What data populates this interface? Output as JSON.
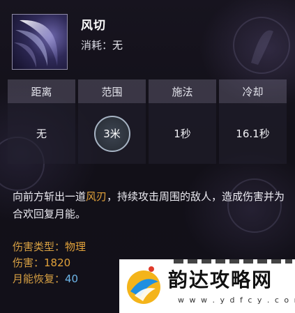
{
  "skill": {
    "name": "风切",
    "cost_label": "消耗：",
    "cost_value": "无"
  },
  "stats": {
    "headers": [
      "距离",
      "范围",
      "施法",
      "冷却"
    ],
    "values": [
      "无",
      "3米",
      "1秒",
      "16.1秒"
    ]
  },
  "description": {
    "prefix": "向前方斩出一道",
    "highlight": "风刃",
    "suffix": "，持续攻击周围的敌人，造成伤害并为合欢回复月能。"
  },
  "attributes": {
    "damage_type_label": "伤害类型：",
    "damage_type_value": "物理",
    "damage_label": "伤害：",
    "damage_value": "1820",
    "moon_energy_label": "月能恢复：",
    "moon_energy_value": "40"
  },
  "watermark": {
    "title": "韵达攻略网",
    "url": "w w w . y d f c y . c o m"
  },
  "colors": {
    "highlight": "#e2a23a",
    "blue_value": "#6eb7ea"
  }
}
